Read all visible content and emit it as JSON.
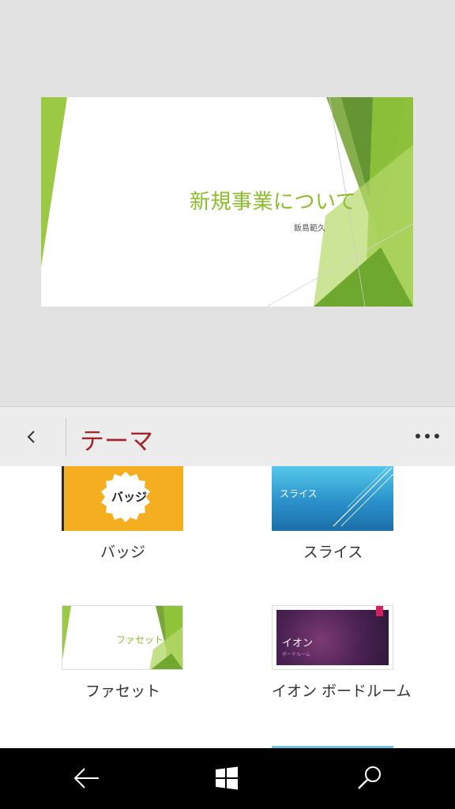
{
  "slide": {
    "title": "新規事業について",
    "subtitle": "飯島範久"
  },
  "panel": {
    "title": "テーマ",
    "back_icon": "chevron-left-icon",
    "more_icon": "ellipsis-icon",
    "title_color": "#a4262c"
  },
  "themes": [
    {
      "name": "バッジ",
      "thumb_text": "バッジ"
    },
    {
      "name": "スライス",
      "thumb_text": "スライス"
    },
    {
      "name": "ファセット",
      "thumb_text": "ファセット"
    },
    {
      "name": "イオン ボードルーム",
      "thumb_text": "イオン",
      "thumb_subtext": "ボードルーム"
    }
  ],
  "navbar": {
    "back_icon": "back-arrow-icon",
    "home_icon": "windows-logo-icon",
    "search_icon": "search-icon"
  },
  "colors": {
    "accent_green": "#8bbd2c",
    "badge_orange": "#f6ae21"
  }
}
